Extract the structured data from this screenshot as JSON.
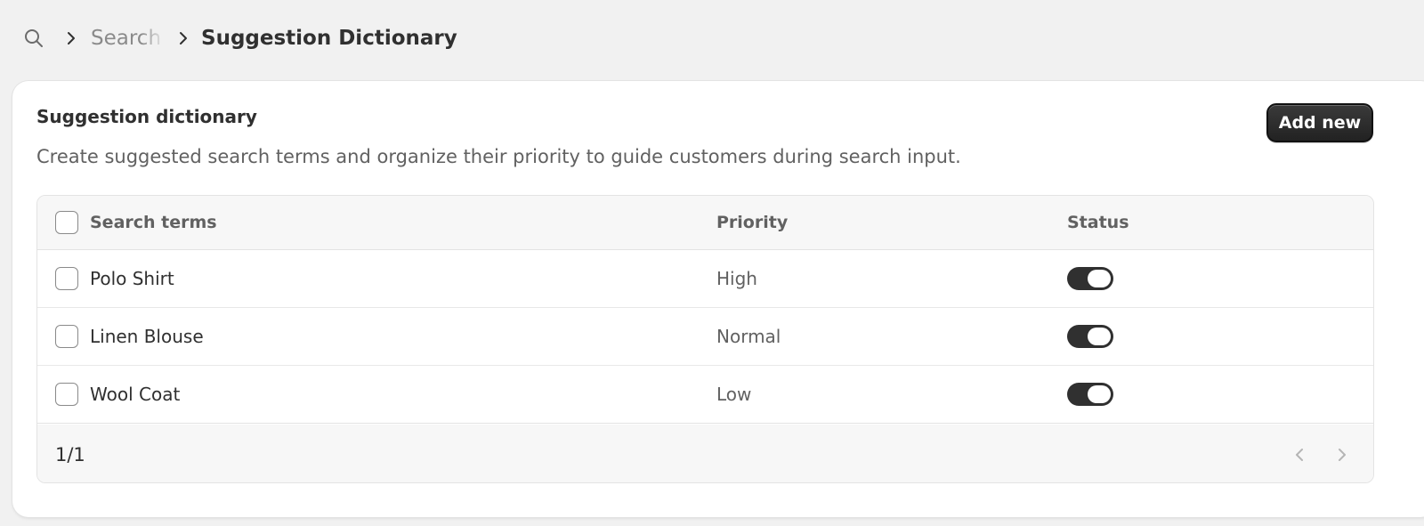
{
  "breadcrumb": {
    "icon": "search-icon",
    "parent": "Search",
    "current": "Suggestion Dictionary"
  },
  "card": {
    "title": "Suggestion dictionary",
    "description": "Create suggested search terms and organize their priority to guide customers during search input.",
    "add_button_label": "Add new"
  },
  "table": {
    "columns": {
      "term": "Search terms",
      "priority": "Priority",
      "status": "Status"
    },
    "rows": [
      {
        "term": "Polo Shirt",
        "priority": "High",
        "status_enabled": true
      },
      {
        "term": "Linen Blouse",
        "priority": "Normal",
        "status_enabled": true
      },
      {
        "term": "Wool Coat",
        "priority": "Low",
        "status_enabled": true
      }
    ],
    "pagination": {
      "label": "1/1",
      "prev_icon": "chevron-left-icon",
      "next_icon": "chevron-right-icon"
    }
  },
  "colors": {
    "background": "#f1f1f1",
    "card": "#ffffff",
    "primary_button": "#303030",
    "toggle_on": "#303030",
    "text_primary": "#303030",
    "text_secondary": "#616161"
  }
}
